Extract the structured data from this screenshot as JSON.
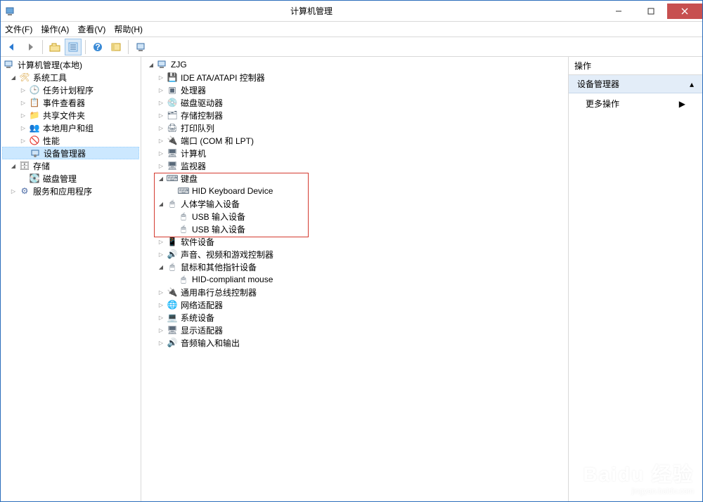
{
  "window": {
    "title": "计算机管理"
  },
  "menubar": {
    "file": "文件(F)",
    "action": "操作(A)",
    "view": "查看(V)",
    "help": "帮助(H)"
  },
  "toolbar": {
    "back": "back",
    "forward": "forward",
    "up": "up",
    "props": "properties",
    "help": "help",
    "show": "show",
    "devmgr": "devmgr"
  },
  "left_tree": {
    "root": "计算机管理(本地)",
    "sys_tools": "系统工具",
    "task_scheduler": "任务计划程序",
    "event_viewer": "事件查看器",
    "shared_folders": "共享文件夹",
    "local_users": "本地用户和组",
    "performance": "性能",
    "device_manager": "设备管理器",
    "storage": "存储",
    "disk_mgmt": "磁盘管理",
    "services_apps": "服务和应用程序"
  },
  "center_tree": {
    "root": "ZJG",
    "ide": "IDE ATA/ATAPI 控制器",
    "cpu": "处理器",
    "dvd": "磁盘驱动器",
    "storage_ctrl": "存储控制器",
    "print_queue": "打印队列",
    "ports": "端口 (COM 和 LPT)",
    "computer": "计算机",
    "monitor": "监视器",
    "keyboard": "键盘",
    "hid_keyboard": "HID Keyboard Device",
    "hid": "人体学输入设备",
    "usb_input1": "USB 输入设备",
    "usb_input2": "USB 输入设备",
    "software_devices": "软件设备",
    "sound": "声音、视频和游戏控制器",
    "mouse": "鼠标和其他指针设备",
    "hid_mouse": "HID-compliant mouse",
    "usb_controller": "通用串行总线控制器",
    "network": "网络适配器",
    "sys_devices": "系统设备",
    "display": "显示适配器",
    "audio_io": "音频输入和输出"
  },
  "right_pane": {
    "header": "操作",
    "section": "设备管理器",
    "more_actions": "更多操作"
  },
  "watermark": {
    "big": "Baidu 经验",
    "small": "jingyan.baidu.com"
  }
}
